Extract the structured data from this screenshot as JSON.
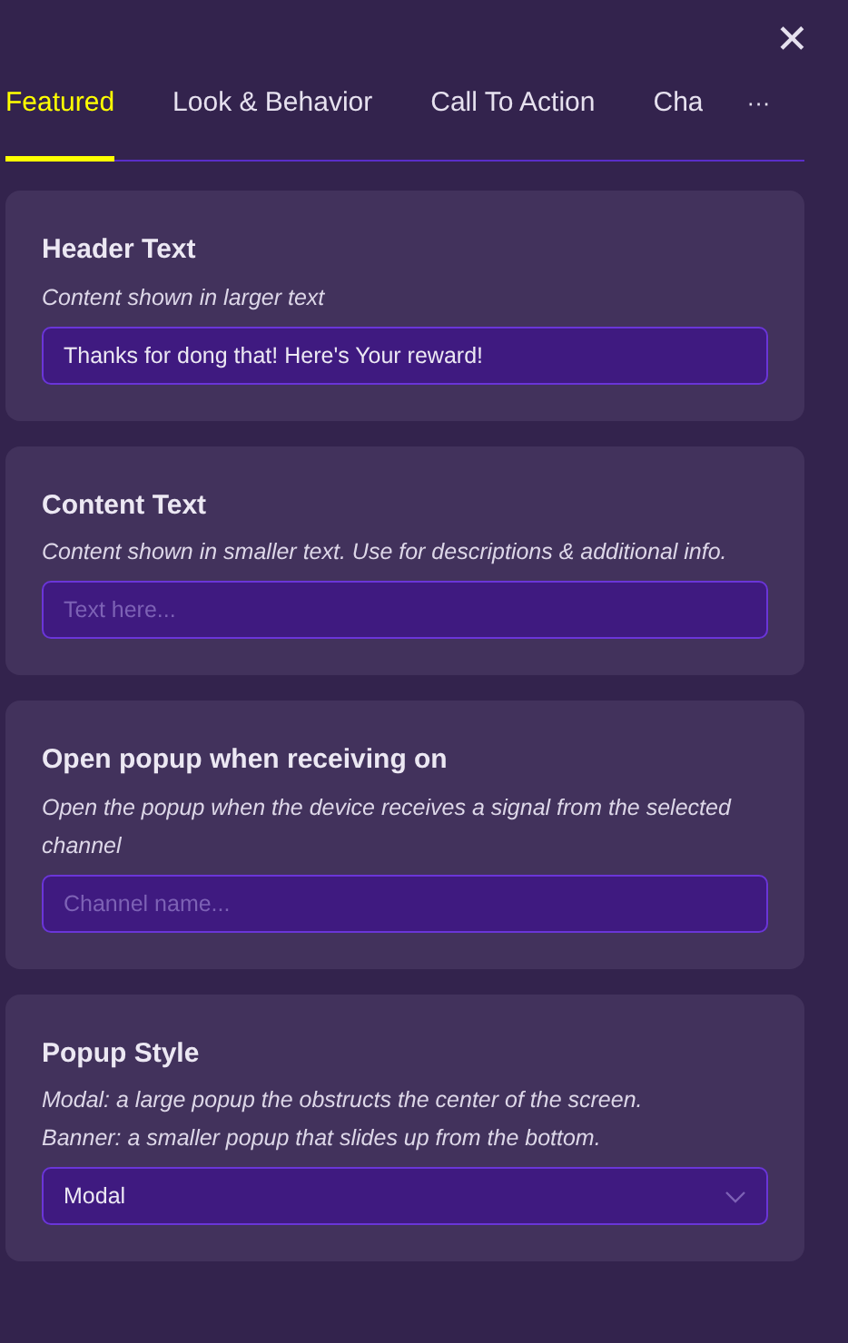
{
  "close_label": "✕",
  "tabs": [
    {
      "label": "Featured",
      "selected": true
    },
    {
      "label": "Look & Behavior",
      "selected": false
    },
    {
      "label": "Call To Action",
      "selected": false
    },
    {
      "label": "Cha",
      "selected": false
    }
  ],
  "more_label": "···",
  "cards": [
    {
      "title": "Header Text",
      "description": [
        "Content shown in larger text"
      ],
      "field": {
        "kind": "text",
        "value": "Thanks for dong that! Here's Your reward!"
      }
    },
    {
      "title": "Content Text",
      "description": [
        "Content shown in smaller text. Use for descriptions & additional info."
      ],
      "field": {
        "kind": "text",
        "placeholder": "Text here..."
      }
    },
    {
      "title": "Open popup when receiving on",
      "description": [
        "Open the popup when the device receives a signal from the selected channel"
      ],
      "field": {
        "kind": "text",
        "placeholder": "Channel name..."
      }
    },
    {
      "title": "Popup Style",
      "description": [
        "Modal: a large popup the obstructs the center of the screen.",
        "Banner: a smaller popup that slides up from the bottom."
      ],
      "field": {
        "kind": "select",
        "value": "Modal"
      }
    }
  ]
}
